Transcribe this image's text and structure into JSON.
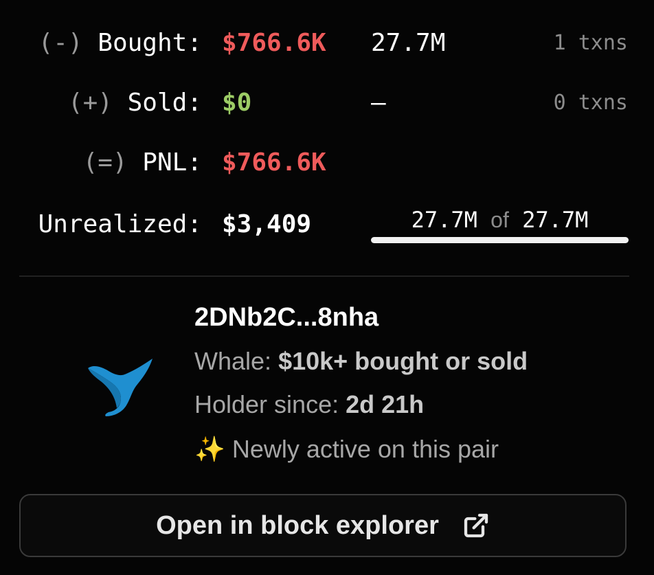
{
  "rows": {
    "bought": {
      "prefix": "(-)",
      "label": "Bought:",
      "value": "$766.6K",
      "amount": "27.7M",
      "txns": "1 txns"
    },
    "sold": {
      "prefix": "(+)",
      "label": "Sold:",
      "value": "$0",
      "amount": "–",
      "txns": "0 txns"
    },
    "pnl": {
      "prefix": "(=)",
      "label": "PNL:",
      "value": "$766.6K"
    },
    "unrealized": {
      "label": "Unrealized:",
      "value": "$3,409"
    }
  },
  "holding": {
    "current": "27.7M",
    "of_label": "of",
    "total": "27.7M",
    "fraction": 1.0
  },
  "wallet": {
    "address": "2DNb2C...8nha",
    "whale_label": "Whale:",
    "whale_value": "$10k+ bought or sold",
    "holder_label": "Holder since:",
    "holder_value": "2d 21h",
    "sparkle": "✨",
    "activity": "Newly active on this pair",
    "icon": "whale-tail-icon"
  },
  "button": {
    "label": "Open in block explorer",
    "icon": "external-link-icon"
  },
  "colors": {
    "negative": "#ef5b5b",
    "positive": "#9ccc65",
    "whale": "#1f8fd0"
  }
}
